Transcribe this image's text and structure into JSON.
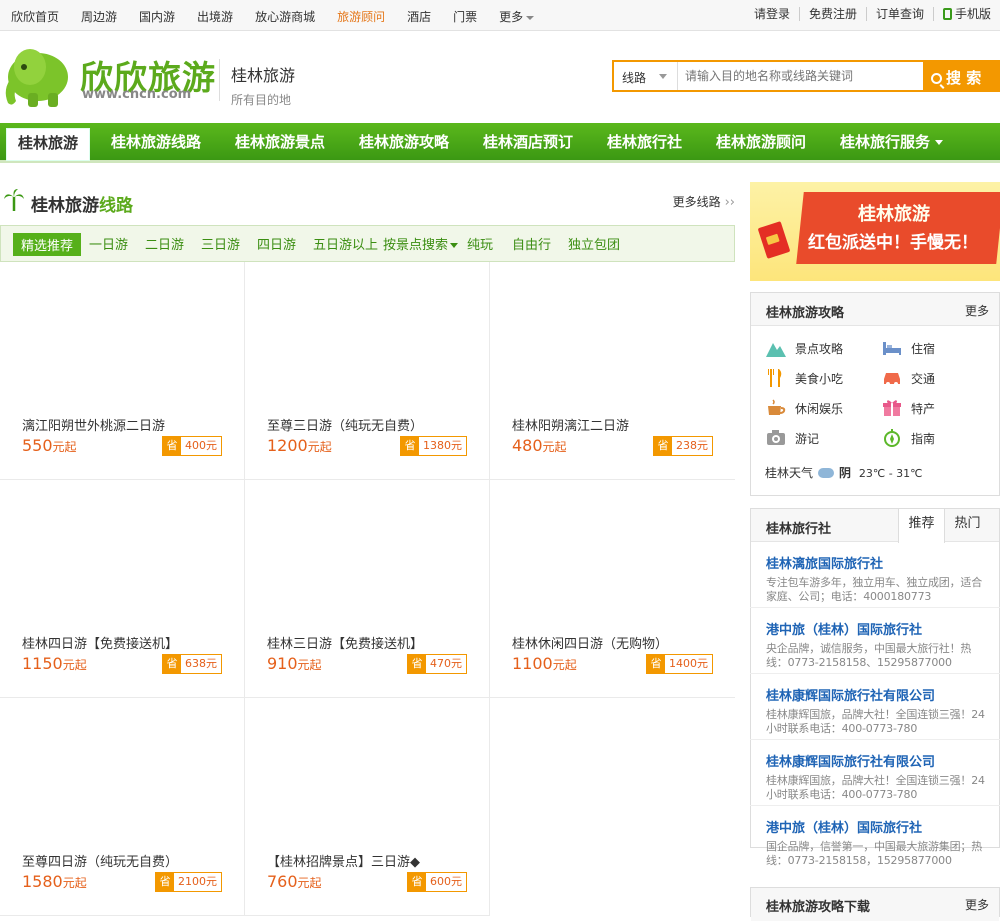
{
  "topbar": {
    "links": [
      "欣欣首页",
      "周边游",
      "国内游",
      "出境游",
      "放心游商城",
      "旅游顾问",
      "酒店",
      "门票",
      "更多"
    ],
    "right": [
      "请登录",
      "免费注册",
      "订单查询",
      "手机版"
    ]
  },
  "header": {
    "logo_text": "欣欣旅游",
    "logo_url": "www.cncn.com",
    "site_title": "桂林旅游",
    "site_sub": "所有目的地",
    "search_type": "线路",
    "search_placeholder": "请输入目的地名称或线路关键词",
    "search_button": "搜 索"
  },
  "nav": {
    "items": [
      "桂林旅游",
      "桂林旅游线路",
      "桂林旅游景点",
      "桂林旅游攻略",
      "桂林酒店预订",
      "桂林旅行社",
      "桂林旅游顾问",
      "桂林旅行服务"
    ]
  },
  "routes": {
    "title_a": "桂林旅游",
    "title_b": "线路",
    "more": "更多线路",
    "tabs": [
      "精选推荐",
      "一日游",
      "二日游",
      "三日游",
      "四日游",
      "五日游以上",
      "按景点搜索",
      "纯玩",
      "自由行",
      "独立包团"
    ],
    "save_label": "省",
    "price_unit": "元起",
    "items": [
      {
        "name": "漓江阳朔世外桃源二日游",
        "price": "550",
        "save": "400元"
      },
      {
        "name": "至尊三日游（纯玩无自费）",
        "price": "1200",
        "save": "1380元"
      },
      {
        "name": "桂林阳朔漓江二日游",
        "price": "480",
        "save": "238元"
      },
      {
        "name": "桂林四日游【免费接送机】",
        "price": "1150",
        "save": "638元"
      },
      {
        "name": "桂林三日游【免费接送机】",
        "price": "910",
        "save": "470元"
      },
      {
        "name": "桂林休闲四日游（无购物）",
        "price": "1100",
        "save": "1400元"
      },
      {
        "name": "至尊四日游（纯玩无自费）",
        "price": "1580",
        "save": "2100元"
      },
      {
        "name": "【桂林招牌景点】三日游◆",
        "price": "760",
        "save": "600元"
      }
    ]
  },
  "banner": {
    "line1": "桂林旅游",
    "line2": "红包派送中！手慢无！"
  },
  "guide": {
    "title": "桂林旅游攻略",
    "more": "更多",
    "items": [
      {
        "label": "景点攻略",
        "icon": "mountain-icon"
      },
      {
        "label": "住宿",
        "icon": "bed-icon"
      },
      {
        "label": "美食小吃",
        "icon": "fork-knife-icon"
      },
      {
        "label": "交通",
        "icon": "car-icon"
      },
      {
        "label": "休闲娱乐",
        "icon": "coffee-icon"
      },
      {
        "label": "特产",
        "icon": "gift-icon"
      },
      {
        "label": "游记",
        "icon": "camera-icon"
      },
      {
        "label": "指南",
        "icon": "compass-icon"
      }
    ],
    "weather_label": "桂林天气",
    "weather": "阴",
    "temp": "23℃ - 31℃"
  },
  "agencies": {
    "title": "桂林旅行社",
    "tabs": [
      "推荐",
      "热门"
    ],
    "items": [
      {
        "name": "桂林漓旅国际旅行社",
        "desc": "专注包车游多年，独立用车、独立成团，适合家庭、公司；电话：4000180773"
      },
      {
        "name": "港中旅（桂林）国际旅行社",
        "desc": "央企品牌，诚信服务，中国最大旅行社！热线：0773-2158158、15295877000"
      },
      {
        "name": "桂林康辉国际旅行社有限公司",
        "desc": "桂林康辉国旅，品牌大社！全国连锁三强！24小时联系电话：400-0773-780"
      },
      {
        "name": "桂林康辉国际旅行社有限公司",
        "desc": "桂林康辉国旅，品牌大社！全国连锁三强！24小时联系电话：400-0773-780"
      },
      {
        "name": "港中旅（桂林）国际旅行社",
        "desc": "国企品牌，信誉第一，中国最大旅游集团；热线：0773-2158158，15295877000"
      }
    ]
  },
  "download": {
    "title": "桂林旅游攻略下载",
    "more": "更多"
  },
  "colors": {
    "green": "#4caf18",
    "orange": "#f39800",
    "price": "#e5601b",
    "link": "#1f64b5"
  }
}
